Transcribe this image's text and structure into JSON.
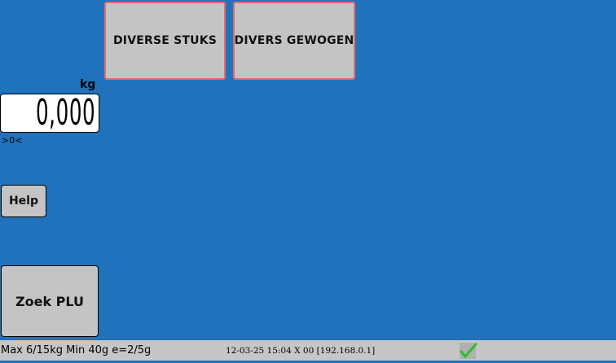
{
  "plu_buttons": [
    {
      "label": "DIVERSE STUKS"
    },
    {
      "label": "DIVERS GEWOGEN"
    }
  ],
  "scale": {
    "unit": "kg",
    "weight": "0,000",
    "zero_indicator": ">0<"
  },
  "buttons": {
    "help": "Help",
    "search_plu": "Zoek PLU"
  },
  "status_bar": {
    "scale_info": "Max 6/15kg Min 40g e=2/5g",
    "datetime_info": "12-03-25 15:04 X 00 [192.168.0.1]",
    "status_icon": "checkmark-icon"
  },
  "colors": {
    "background": "#1f72bb",
    "button_grey": "#c4c4c4",
    "plu_border": "#e86a6a",
    "status_bar": "#c6c6c6",
    "check_green": "#2fbf2f"
  }
}
